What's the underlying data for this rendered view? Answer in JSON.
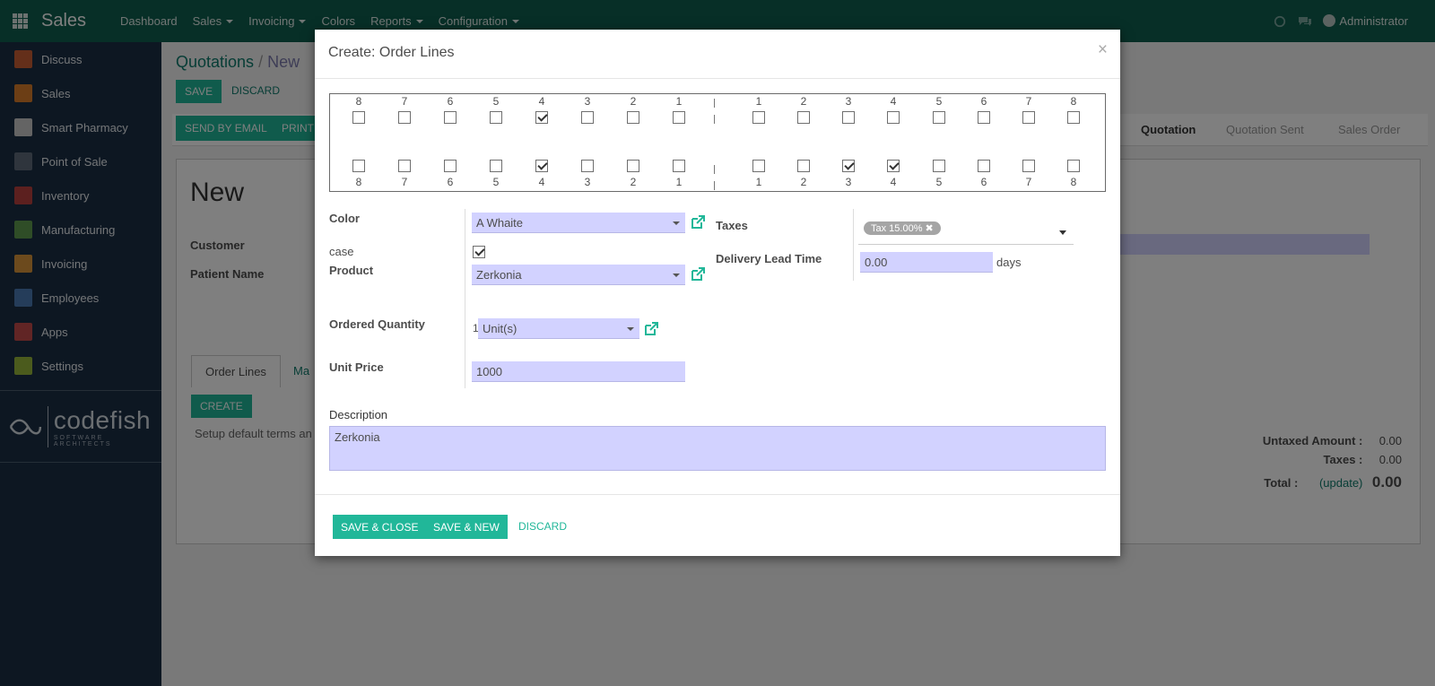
{
  "app": {
    "brand": "Sales",
    "menu": [
      "Dashboard",
      "Sales",
      "Invoicing",
      "Colors",
      "Reports",
      "Configuration"
    ],
    "user": "Administrator"
  },
  "sidebar": {
    "items": [
      {
        "label": "Discuss",
        "color": "#c95f35"
      },
      {
        "label": "Sales",
        "color": "#d97c2a"
      },
      {
        "label": "Smart Pharmacy",
        "color": "#c9c9c9"
      },
      {
        "label": "Point of Sale",
        "color": "#5e6b7a"
      },
      {
        "label": "Inventory",
        "color": "#b8403e"
      },
      {
        "label": "Manufacturing",
        "color": "#5e9a4f"
      },
      {
        "label": "Invoicing",
        "color": "#d9953a"
      },
      {
        "label": "Employees",
        "color": "#4b7bb5"
      },
      {
        "label": "Apps",
        "color": "#c24b4b"
      },
      {
        "label": "Settings",
        "color": "#96b63a"
      }
    ],
    "logo": {
      "main": "codefish",
      "sub": "SOFTWARE ARCHITECTS"
    }
  },
  "background": {
    "breadcrumb_root": "Quotations",
    "breadcrumb_current": "New",
    "save": "SAVE",
    "discard": "DISCARD",
    "send_email": "SEND BY EMAIL",
    "print": "PRINT",
    "stages": [
      "Quotation",
      "Quotation Sent",
      "Sales Order"
    ],
    "record_title": "New",
    "customer_label": "Customer",
    "patient_label": "Patient Name",
    "tab_order_lines": "Order Lines",
    "tab_other": "Ma",
    "create": "CREATE",
    "terms": "Setup default terms an",
    "totals": {
      "untaxed_label": "Untaxed Amount :",
      "untaxed_value": "0.00",
      "taxes_label": "Taxes :",
      "taxes_value": "0.00",
      "total_label": "Total :",
      "update": "(update)",
      "total_value": "0.00"
    }
  },
  "modal": {
    "title": "Create: Order Lines",
    "close": "×",
    "teeth_top": [
      {
        "num": "8",
        "checked": false
      },
      {
        "num": "7",
        "checked": false
      },
      {
        "num": "6",
        "checked": false
      },
      {
        "num": "5",
        "checked": false
      },
      {
        "num": "4",
        "checked": true
      },
      {
        "num": "3",
        "checked": false
      },
      {
        "num": "2",
        "checked": false
      },
      {
        "num": "1",
        "checked": false
      },
      {
        "num": "1",
        "checked": false
      },
      {
        "num": "2",
        "checked": false
      },
      {
        "num": "3",
        "checked": false
      },
      {
        "num": "4",
        "checked": false
      },
      {
        "num": "5",
        "checked": false
      },
      {
        "num": "6",
        "checked": false
      },
      {
        "num": "7",
        "checked": false
      },
      {
        "num": "8",
        "checked": false
      }
    ],
    "teeth_bottom": [
      {
        "num": "8",
        "checked": false
      },
      {
        "num": "7",
        "checked": false
      },
      {
        "num": "6",
        "checked": false
      },
      {
        "num": "5",
        "checked": false
      },
      {
        "num": "4",
        "checked": true
      },
      {
        "num": "3",
        "checked": false
      },
      {
        "num": "2",
        "checked": false
      },
      {
        "num": "1",
        "checked": false
      },
      {
        "num": "1",
        "checked": false
      },
      {
        "num": "2",
        "checked": false
      },
      {
        "num": "3",
        "checked": true
      },
      {
        "num": "4",
        "checked": true
      },
      {
        "num": "5",
        "checked": false
      },
      {
        "num": "6",
        "checked": false
      },
      {
        "num": "7",
        "checked": false
      },
      {
        "num": "8",
        "checked": false
      }
    ],
    "color_label": "Color",
    "color_value": "A Whaite",
    "case_label": "case",
    "case_checked": true,
    "product_label": "Product",
    "product_value": "Zerkonia",
    "qty_label": "Ordered Quantity",
    "qty_value": "1",
    "uom_value": "Unit(s)",
    "price_label": "Unit Price",
    "price_value": "1000",
    "taxes_label": "Taxes",
    "tax_tag": "Tax 15.00%",
    "lead_label": "Delivery Lead Time",
    "lead_value": "0.00",
    "lead_unit": "days",
    "desc_label": "Description",
    "desc_value": "Zerkonia",
    "save_close": "SAVE & CLOSE",
    "save_new": "SAVE & NEW",
    "discard": "DISCARD"
  }
}
